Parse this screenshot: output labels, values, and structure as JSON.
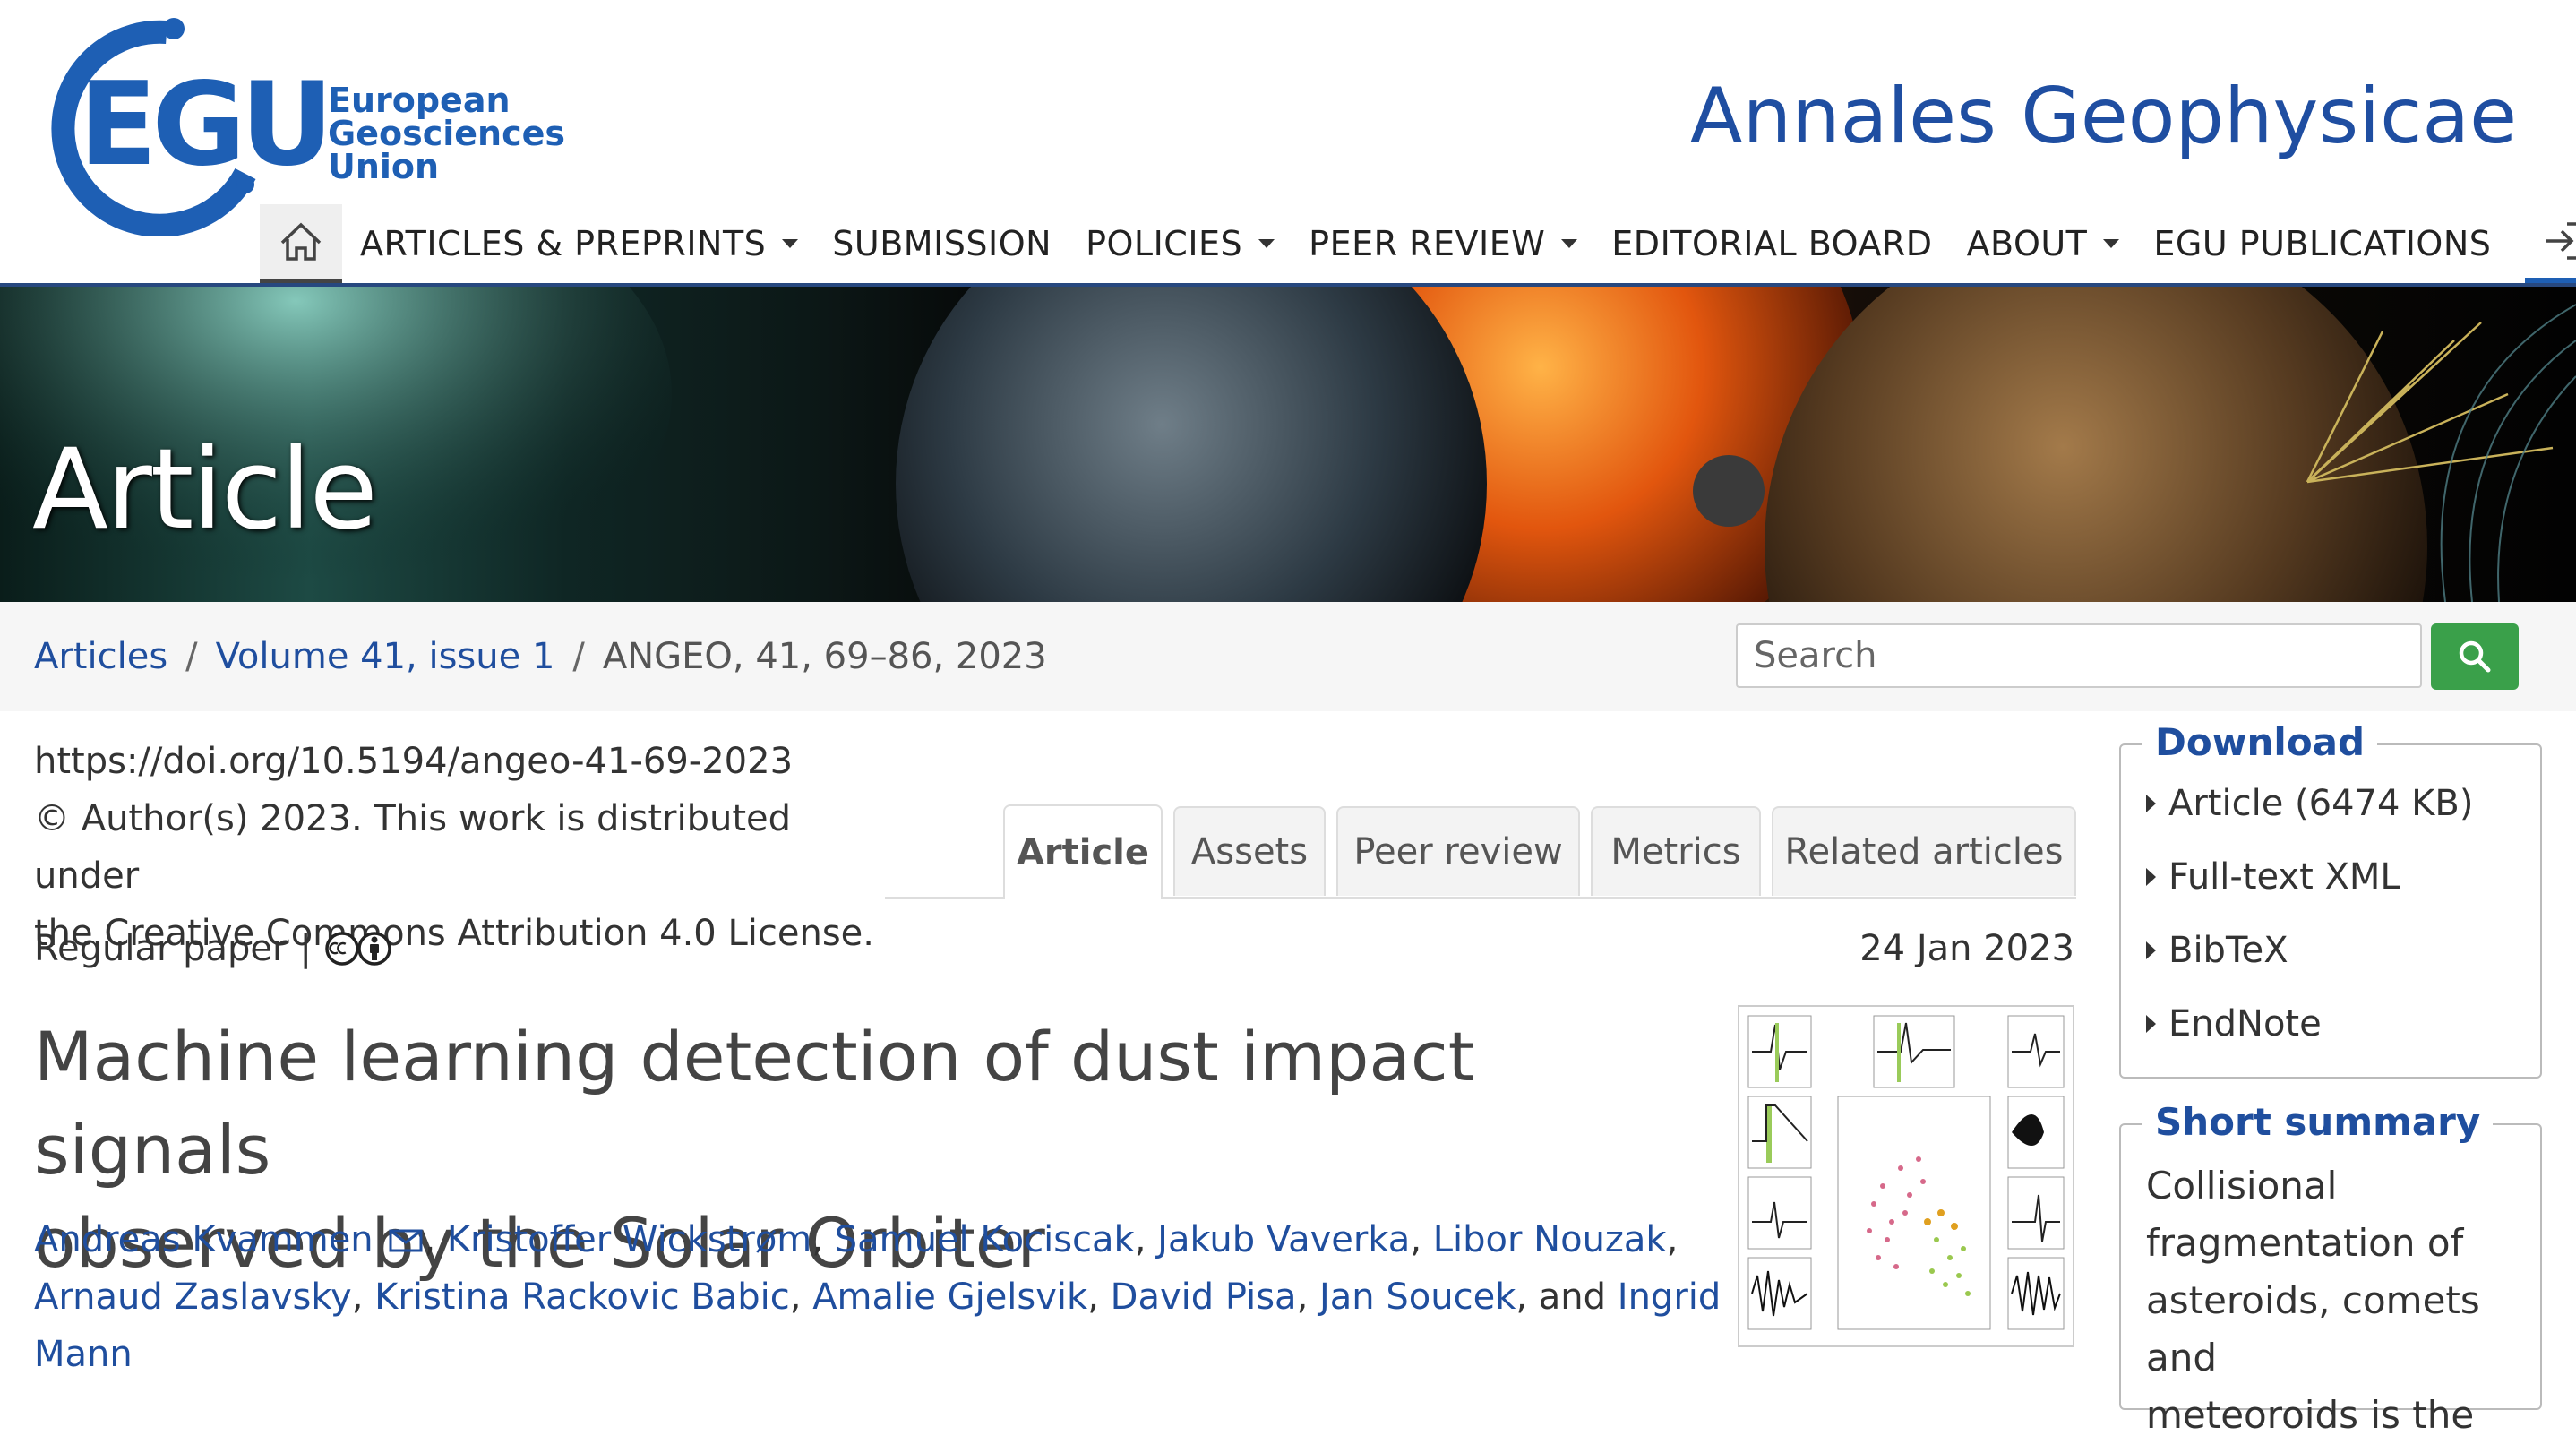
{
  "header": {
    "logo_main": "EGU",
    "logo_sub": [
      "European",
      "Geosciences",
      "Union"
    ],
    "journal_title": "Annales Geophysicae"
  },
  "nav": {
    "items": [
      {
        "label": "ARTICLES & PREPRINTS",
        "dropdown": true
      },
      {
        "label": "SUBMISSION",
        "dropdown": false
      },
      {
        "label": "POLICIES",
        "dropdown": true
      },
      {
        "label": "PEER REVIEW",
        "dropdown": true
      },
      {
        "label": "EDITORIAL BOARD",
        "dropdown": false
      },
      {
        "label": "ABOUT",
        "dropdown": true
      },
      {
        "label": "EGU PUBLICATIONS",
        "dropdown": false
      }
    ],
    "home_icon": "home-icon",
    "login_icon": "login-icon"
  },
  "banner": {
    "title": "Article"
  },
  "breadcrumb": {
    "articles": "Articles",
    "volume": "Volume 41, issue 1",
    "current": "ANGEO, 41, 69–86, 2023",
    "separator": "/"
  },
  "search": {
    "placeholder": "Search"
  },
  "meta": {
    "doi": "https://doi.org/10.5194/angeo-41-69-2023",
    "license_line1": "© Author(s) 2023. This work is distributed under",
    "license_line2": "the Creative Commons Attribution 4.0 License."
  },
  "tabs": [
    "Article",
    "Assets",
    "Peer review",
    "Metrics",
    "Related articles"
  ],
  "paper": {
    "type": "Regular paper",
    "type_sep": "|",
    "date": "24 Jan 2023",
    "title_line1": "Machine learning detection of dust impact signals",
    "title_line2": "observed by the Solar Orbiter",
    "authors": [
      "Andreas Kvammen",
      "Kristoffer Wickstrøm",
      "Samuel Kociscak",
      "Jakub Vaverka",
      "Libor Nouzak",
      "Arnaud Zaslavsky",
      "Kristina Rackovic Babic",
      "Amalie Gjelsvik",
      "David Pisa",
      "Jan Soucek",
      "Ingrid Mann"
    ],
    "authors_and": "and"
  },
  "download": {
    "legend": "Download",
    "items": [
      {
        "label": "Article",
        "extra": "(6474 KB)"
      },
      {
        "label": "Full-text XML",
        "extra": ""
      },
      {
        "label": "BibTeX",
        "extra": ""
      },
      {
        "label": "EndNote",
        "extra": ""
      }
    ]
  },
  "summary": {
    "legend": "Short summary",
    "text_lines": [
      "Collisional",
      "fragmentation of",
      "asteroids, comets and",
      "meteoroids is the"
    ]
  },
  "colors": {
    "brand_blue": "#1f4e9e",
    "search_green": "#3aa04a",
    "nav_rule": "#27487f"
  }
}
